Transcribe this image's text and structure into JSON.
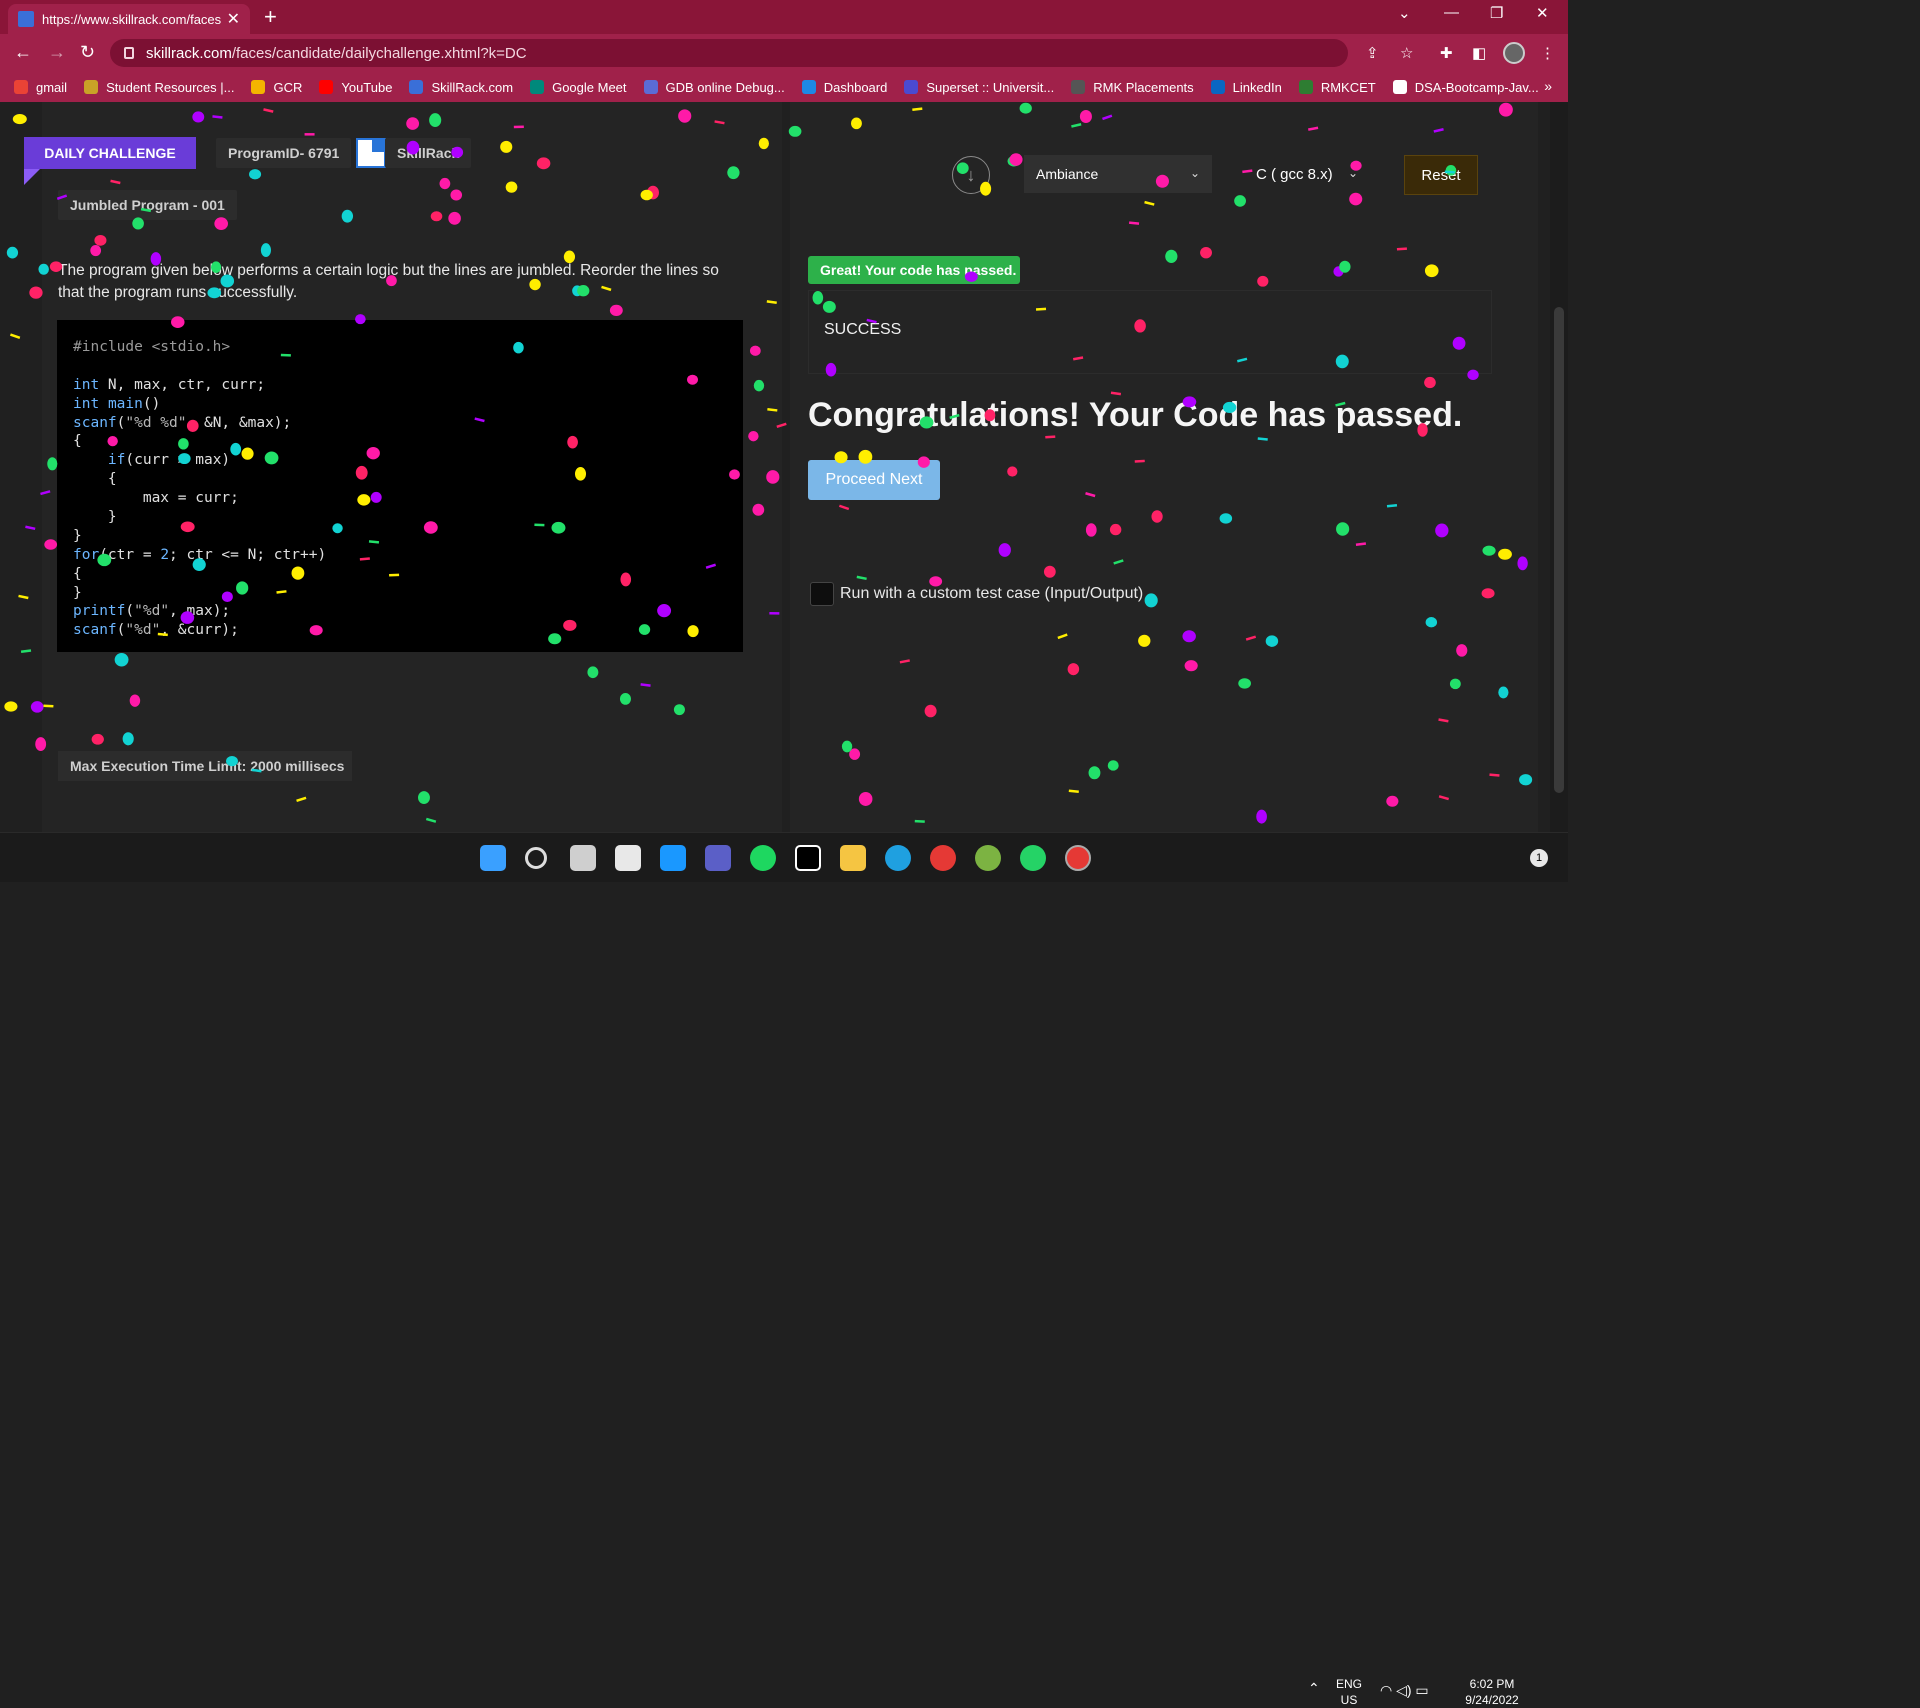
{
  "browser": {
    "tab_title": "https://www.skillrack.com/faces/c",
    "url_host": "skillrack.com",
    "url_path": "/faces/candidate/dailychallenge.xhtml?k=DC",
    "bookmarks": [
      {
        "label": "gmail",
        "color": "#ea4335"
      },
      {
        "label": "Student Resources |...",
        "color": "#c9a227"
      },
      {
        "label": "GCR",
        "color": "#f4b400"
      },
      {
        "label": "YouTube",
        "color": "#ff0000"
      },
      {
        "label": "SkillRack.com",
        "color": "#3a6fd8"
      },
      {
        "label": "Google Meet",
        "color": "#00897b"
      },
      {
        "label": "GDB online Debug...",
        "color": "#5b6bd6"
      },
      {
        "label": "Dashboard",
        "color": "#1e88e5"
      },
      {
        "label": "Superset :: Universit...",
        "color": "#4a4ad0"
      },
      {
        "label": "RMK Placements",
        "color": "#555555"
      },
      {
        "label": "LinkedIn",
        "color": "#0a66c2"
      },
      {
        "label": "RMKCET",
        "color": "#2e7d32"
      },
      {
        "label": "DSA-Bootcamp-Jav...",
        "color": "#ffffff"
      }
    ]
  },
  "header": {
    "daily_challenge": "DAILY CHALLENGE",
    "program_id": "ProgramID- 6791",
    "brand": "SkillRack",
    "title_chip": "Jumbled Program - 001"
  },
  "problem": {
    "description": "The program given below performs a certain logic but the lines are jumbled. Reorder the lines so that the program runs successfully.",
    "code_lines": [
      "#include <stdio.h>",
      "",
      "int N, max, ctr, curr;",
      "int main()",
      "scanf(\"%d %d\", &N, &max);",
      "{",
      "    if(curr > max)",
      "    {",
      "        max = curr;",
      "    }",
      "}",
      "for(ctr = 2; ctr <= N; ctr++)",
      "{",
      "}",
      "printf(\"%d\", max);",
      "scanf(\"%d\", &curr);"
    ],
    "max_time": "Max Execution Time Limit: 2000 millisecs"
  },
  "controls": {
    "theme_value": "Ambiance",
    "language_value": "C ( gcc 8.x)",
    "reset_label": "Reset"
  },
  "result": {
    "badge": "Great! Your code has passed.",
    "status": "SUCCESS",
    "congrats": "Congratulations! Your Code has passed.",
    "proceed_label": "Proceed Next",
    "custom_test_label": "Run with a custom test case (Input/Output)"
  },
  "taskbar": {
    "lang_top": "ENG",
    "lang_bottom": "US",
    "time": "6:02 PM",
    "date": "9/24/2022",
    "notification_count": "1"
  },
  "colors": {
    "chrome_theme": "#a0214a",
    "accent_purple": "#6a3cd8",
    "success_green": "#2db14a",
    "proceed_blue": "#7bb7e8"
  }
}
